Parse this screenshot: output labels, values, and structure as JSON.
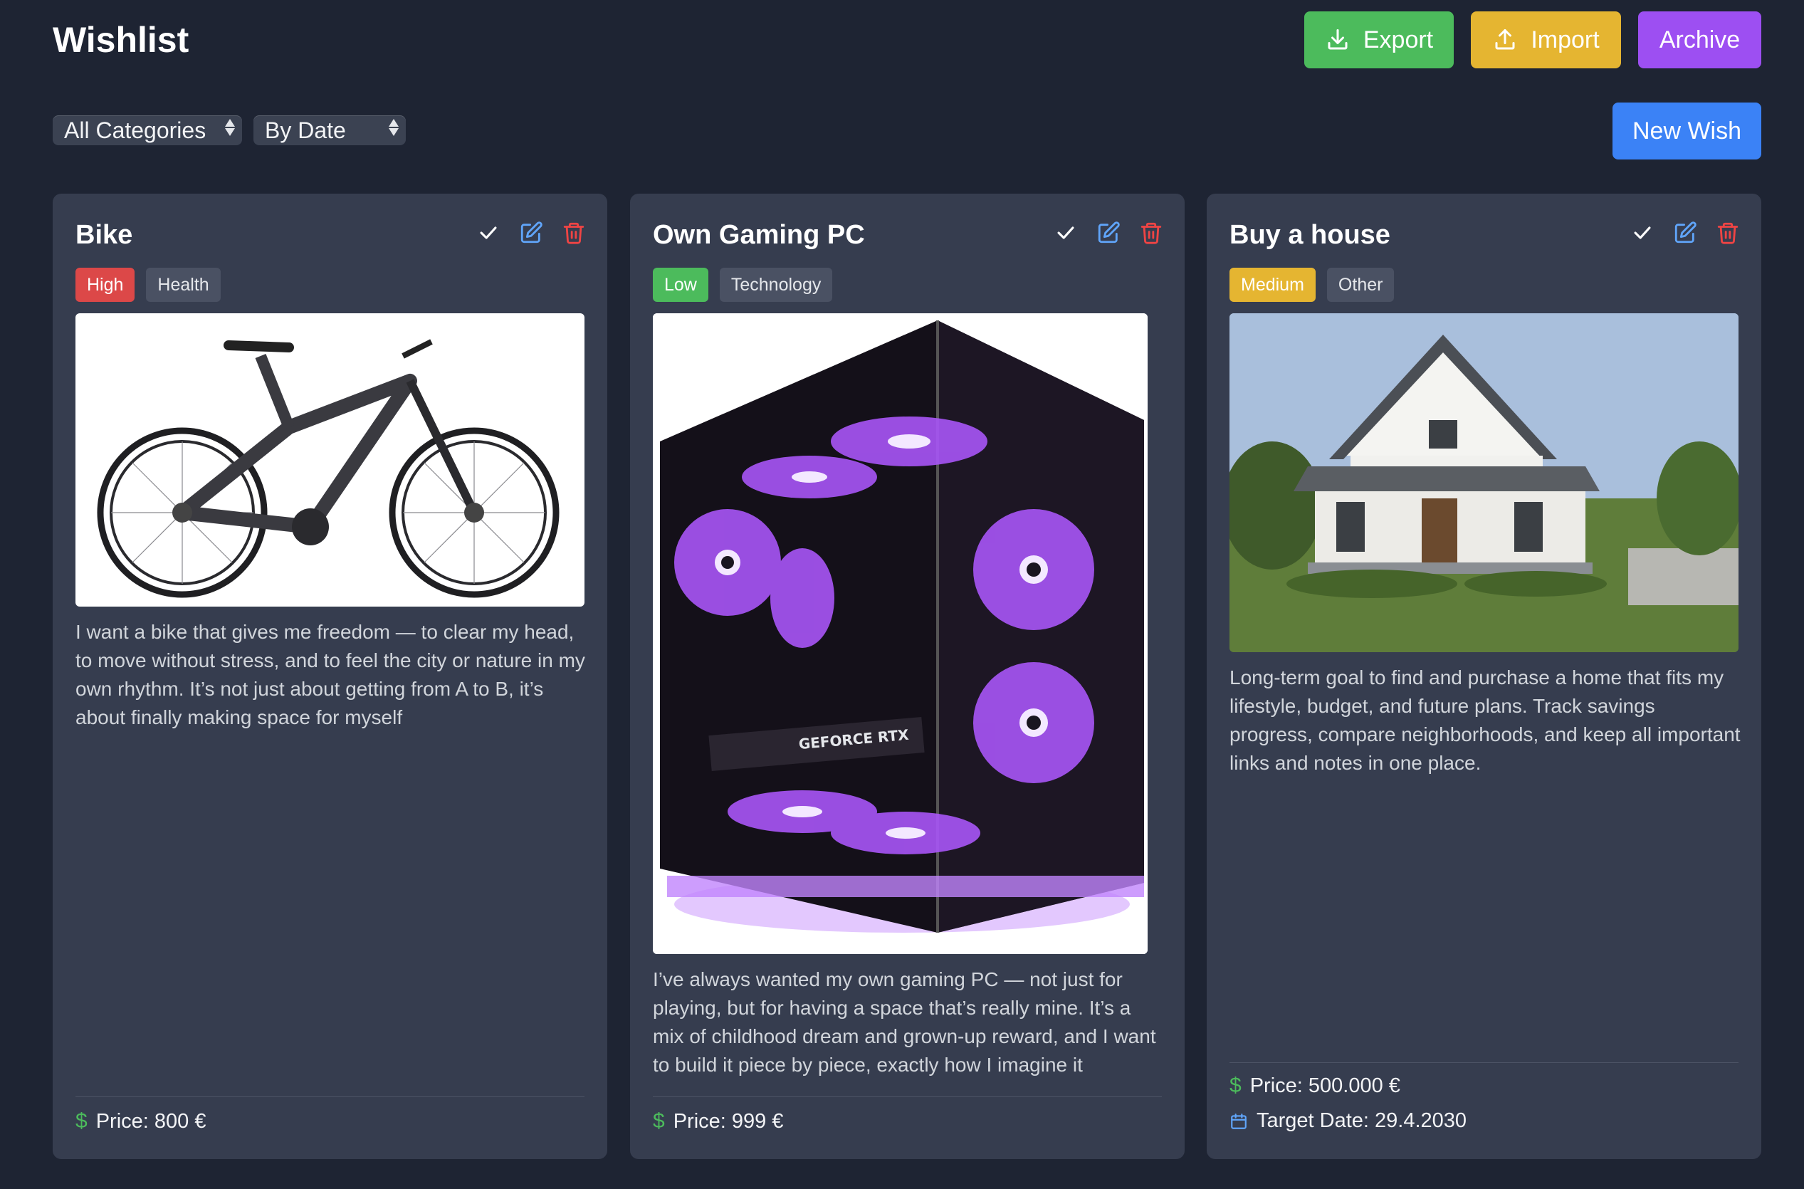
{
  "header": {
    "title": "Wishlist",
    "export_label": "Export",
    "import_label": "Import",
    "archive_label": "Archive",
    "new_wish_label": "New Wish"
  },
  "filters": {
    "category": "All Categories",
    "sort": "By Date"
  },
  "colors": {
    "background": "#1e2433",
    "card": "#363d4f",
    "export": "#4cbb5c",
    "import": "#e5b531",
    "archive": "#9d4ff2",
    "new_wish": "#3b82f6",
    "priority_high": "#dc4848",
    "priority_low": "#4cbb5c",
    "priority_medium": "#e5b531"
  },
  "cards": [
    {
      "title": "Bike",
      "priority": "High",
      "category": "Health",
      "image": "bike",
      "description": "I want a bike that gives me freedom — to clear my head, to move without stress, and to feel the city or nature in my own rhythm. It’s not just about getting from A to B, it’s about finally making space for myself",
      "price": "Price: 800 €"
    },
    {
      "title": "Own Gaming PC",
      "priority": "Low",
      "category": "Technology",
      "image": "gaming-pc",
      "image_text": "GEFORCE RTX",
      "description": "I’ve always wanted my own gaming PC — not just for playing, but for having a space that’s really mine. It’s a mix of childhood dream and grown-up reward, and I want to build it piece by piece, exactly how I imagine it",
      "price": "Price: 999 €"
    },
    {
      "title": "Buy a house",
      "priority": "Medium",
      "category": "Other",
      "image": "house",
      "description": "Long-term goal to find and purchase a home that fits my lifestyle, budget, and future plans. Track savings progress, compare neighborhoods, and keep all important links and notes in one place.",
      "price": "Price: 500.000 €",
      "target_date": "Target Date: 29.4.2030"
    }
  ],
  "icons": {
    "complete": "check-icon",
    "edit": "edit-icon",
    "delete": "trash-icon",
    "price": "dollar-icon",
    "date": "calendar-icon",
    "export": "download-icon",
    "import": "upload-icon"
  }
}
